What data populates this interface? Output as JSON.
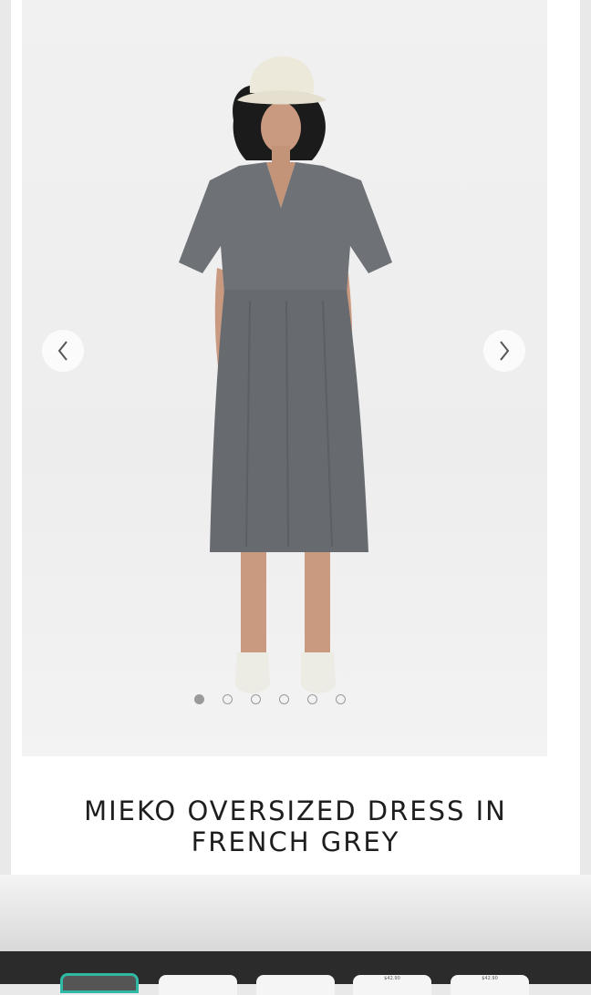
{
  "product": {
    "title_line1": "MIEKO OVERSIZED DRESS IN",
    "title_line2": "FRENCH GREY"
  },
  "carousel": {
    "slide_count": 6,
    "active_index": 0
  },
  "thumbnails": [
    {
      "price": ""
    },
    {
      "price": ""
    },
    {
      "price": ""
    },
    {
      "price": "$42.90"
    },
    {
      "price": "$42.90"
    }
  ],
  "colors": {
    "accent": "#2fb8a4",
    "dress": "#6e7277",
    "hat": "#ece8da"
  }
}
